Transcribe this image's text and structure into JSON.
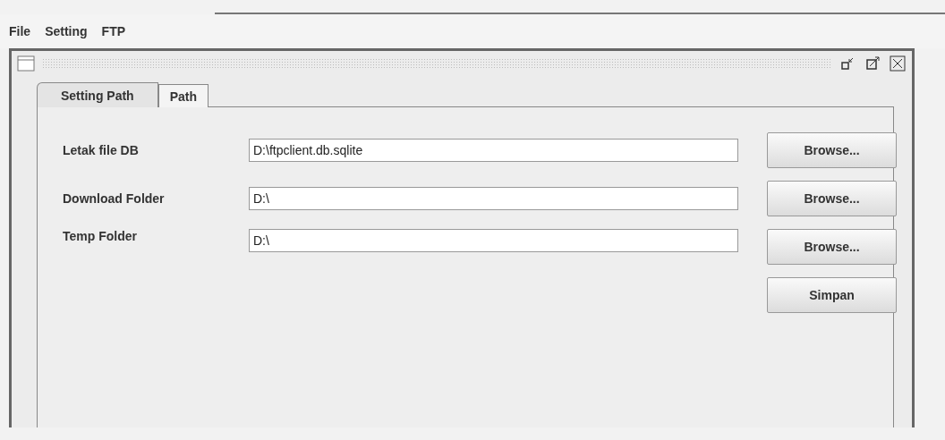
{
  "menu": [
    "File",
    "Setting",
    "FTP"
  ],
  "tabs": [
    {
      "label": "Setting Path",
      "selected": true
    },
    {
      "label": "Path",
      "selected": false
    }
  ],
  "rows": [
    {
      "label": "Letak file DB",
      "value": "D:\\ftpclient.db.sqlite",
      "button": "Browse..."
    },
    {
      "label": "Download Folder",
      "value": "D:\\",
      "button": "Browse..."
    },
    {
      "label": "Temp Folder",
      "value": "D:\\",
      "button": "Browse..."
    }
  ],
  "save_button": "Simpan"
}
